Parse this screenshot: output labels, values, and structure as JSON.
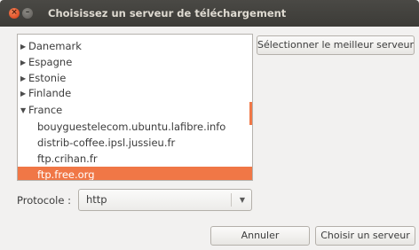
{
  "window": {
    "title": "Choisissez un serveur de téléchargement",
    "close_glyph": "×",
    "minimize_glyph": "–"
  },
  "server_list": {
    "rows": [
      {
        "label": "Danemark",
        "expander": "▶",
        "expanded": false,
        "selected": false
      },
      {
        "label": "Espagne",
        "expander": "▶",
        "expanded": false,
        "selected": false
      },
      {
        "label": "Estonie",
        "expander": "▶",
        "expanded": false,
        "selected": false
      },
      {
        "label": "Finlande",
        "expander": "▶",
        "expanded": false,
        "selected": false
      },
      {
        "label": "France",
        "expander": "▼",
        "expanded": true,
        "selected": false
      },
      {
        "label": "bouyguestelecom.ubuntu.lafibre.info",
        "selected": false
      },
      {
        "label": "distrib-coffee.ipsl.jussieu.fr",
        "selected": false
      },
      {
        "label": "ftp.crihan.fr",
        "selected": false
      },
      {
        "label": "ftp.free.org",
        "selected": true
      }
    ]
  },
  "buttons": {
    "best_server": "Sélectionner le meilleur serveur",
    "cancel": "Annuler",
    "choose": "Choisir un serveur"
  },
  "protocol": {
    "label": "Protocole :",
    "value": "http",
    "arrow_glyph": "▼"
  },
  "colors": {
    "accent": "#f07746",
    "title_bar": "#3c3b37"
  }
}
